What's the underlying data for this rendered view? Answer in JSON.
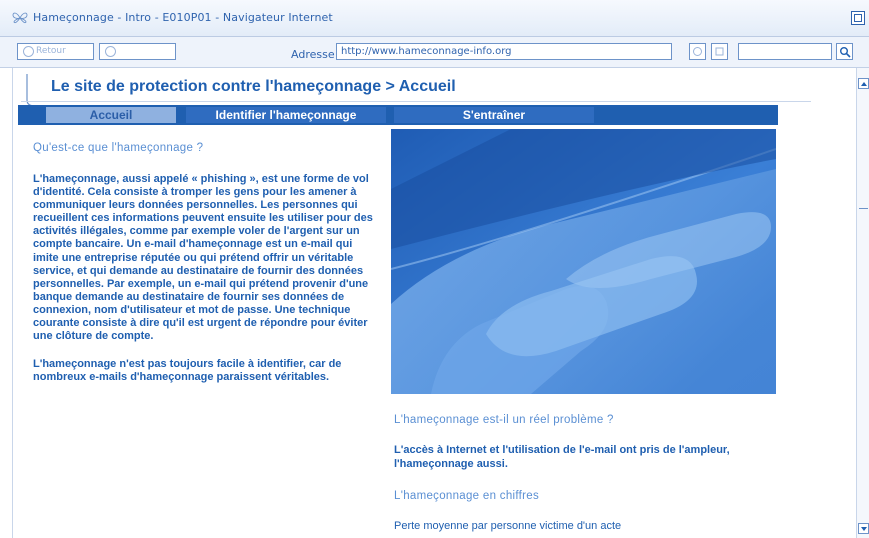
{
  "window": {
    "title": "Hameçonnage - Intro - E010P01 - Navigateur Internet"
  },
  "toolbar": {
    "back_label": "Retour",
    "address_label": "Adresse",
    "address_value": "http://www.hameconnage-info.org",
    "search_value": ""
  },
  "header": {
    "title": "Le site de protection contre l'hameçonnage > Accueil"
  },
  "nav": {
    "tabs": [
      {
        "label": "Accueil",
        "active": true
      },
      {
        "label": "Identifier l'hameçonnage",
        "active": false
      },
      {
        "label": "S'entraîner",
        "active": false
      }
    ]
  },
  "left": {
    "heading": "Qu'est-ce que l'hameçonnage ?",
    "paragraphs": [
      "L'hameçonnage, aussi appelé « phishing », est une forme de vol d'identité. Cela consiste à tromper les gens pour les amener à communiquer leurs données personnelles. Les personnes qui recueillent ces informations peuvent ensuite les utiliser pour des activités illégales, comme par exemple voler de l'argent sur un compte bancaire. Un e-mail d'hameçonnage est un e-mail qui imite une entreprise réputée ou qui prétend offrir un véritable service, et qui demande au destinataire de fournir des données personnelles. Par exemple, un e-mail qui prétend provenir d'une banque demande au destinataire de fournir ses données de connexion, nom d'utilisateur et mot de passe. Une technique courante consiste à dire qu'il est urgent de répondre pour éviter une clôture de compte.",
      "L'hameçonnage n'est pas toujours facile à identifier, car de nombreux e-mails d'hameçonnage paraissent véritables."
    ]
  },
  "right": {
    "heading1": "L'hameçonnage est-il un réel problème ?",
    "paragraph1": "L'accès à Internet et l'utilisation de l'e-mail ont pris de l'ampleur, l'hameçonnage aussi.",
    "heading2": "L'hameçonnage en chiffres",
    "paragraph2": "Perte moyenne par personne victime d'un acte"
  },
  "colors": {
    "brand_blue": "#1f5fb0",
    "light_blue": "#5a8fd3",
    "tab_active": "#8fb1e0"
  }
}
